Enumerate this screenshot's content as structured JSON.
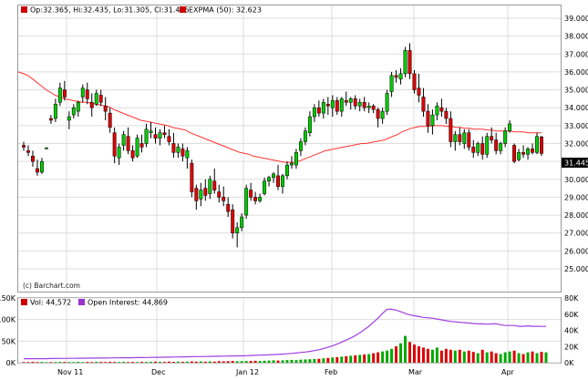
{
  "price_panel": {
    "legend": {
      "ohlc": "Op:32.365, Hi:32.435, Lo:31.305, Cl:31.445",
      "ema": "EXPMA (50): 32.623"
    },
    "watermark": "(c) Barchart.com",
    "last_price": "31.445",
    "colors": {
      "up": "#00cc00",
      "down": "#e00000",
      "ema": "#ff3333",
      "grid": "#dddddd",
      "legend_square": "#cc0000"
    }
  },
  "volume_panel": {
    "legend": {
      "volume": "Vol: 44,572",
      "open_interest": "Open Interest: 44,869"
    },
    "colors": {
      "volume_up": "#00aa00",
      "volume_down": "#dd0000",
      "open_interest": "#a040e0",
      "legend_square": "#cc0000",
      "oi_square": "#9933cc"
    }
  },
  "x_axis": {
    "labels": [
      "Nov 11",
      "Dec",
      "Jan 12",
      "Feb",
      "Mar",
      "Apr"
    ]
  },
  "chart_data": {
    "type": "candlestick",
    "price_axis": {
      "ticks": [
        "39.000",
        "38.000",
        "37.000",
        "36.000",
        "35.000",
        "34.000",
        "33.000",
        "32.000",
        "31.000",
        "30.000",
        "29.000",
        "28.000",
        "27.000",
        "26.000",
        "25.000"
      ],
      "range": [
        24.5,
        39.5
      ]
    },
    "volume_axis_left": {
      "ticks": [
        "0K",
        "50K",
        "100K",
        "150K"
      ],
      "range": [
        0,
        150000
      ]
    },
    "open_interest_axis_right": {
      "ticks": [
        "0K",
        "20K",
        "40K",
        "60K",
        "80K"
      ],
      "range": [
        0,
        80000
      ]
    },
    "candles": [
      [
        31.9,
        32.1,
        31.6,
        31.8
      ],
      [
        31.6,
        31.9,
        31.3,
        31.5
      ],
      [
        31.3,
        31.6,
        30.7,
        31.0
      ],
      [
        30.6,
        31.1,
        30.2,
        30.4
      ],
      [
        30.4,
        31.2,
        30.3,
        31.0
      ],
      [
        31.75,
        31.8,
        31.7,
        31.75
      ],
      [
        33.4,
        33.6,
        33.1,
        33.3
      ],
      [
        33.4,
        34.5,
        33.2,
        34.2
      ],
      [
        34.3,
        35.4,
        34.1,
        35.1
      ],
      [
        35.0,
        35.5,
        34.4,
        34.6
      ],
      [
        33.3,
        33.8,
        32.8,
        33.5
      ],
      [
        33.6,
        34.2,
        33.4,
        34.0
      ],
      [
        33.8,
        34.4,
        33.5,
        34.3
      ],
      [
        34.6,
        35.3,
        34.3,
        35.1
      ],
      [
        35.0,
        35.4,
        34.2,
        34.5
      ],
      [
        34.3,
        34.8,
        33.5,
        34.0
      ],
      [
        34.2,
        35.0,
        34.1,
        34.8
      ],
      [
        34.7,
        35.0,
        34.1,
        34.3
      ],
      [
        34.1,
        34.6,
        33.3,
        33.8
      ],
      [
        33.7,
        34.0,
        32.6,
        32.9
      ],
      [
        32.6,
        32.9,
        30.9,
        31.3
      ],
      [
        31.2,
        32.0,
        30.8,
        31.8
      ],
      [
        31.9,
        32.7,
        31.6,
        32.5
      ],
      [
        32.4,
        32.9,
        31.4,
        31.6
      ],
      [
        31.6,
        31.9,
        31.0,
        31.2
      ],
      [
        31.3,
        32.5,
        31.2,
        32.3
      ],
      [
        32.0,
        32.5,
        31.5,
        31.8
      ],
      [
        32.0,
        33.1,
        31.8,
        32.8
      ],
      [
        32.6,
        33.2,
        32.3,
        32.7
      ],
      [
        32.5,
        32.9,
        32.0,
        32.3
      ],
      [
        32.3,
        32.8,
        31.9,
        32.6
      ],
      [
        32.6,
        33.0,
        32.3,
        32.5
      ],
      [
        32.4,
        32.8,
        31.9,
        32.1
      ],
      [
        32.0,
        32.6,
        31.2,
        31.5
      ],
      [
        31.5,
        32.0,
        31.2,
        31.8
      ],
      [
        31.7,
        32.0,
        31.0,
        31.3
      ],
      [
        31.2,
        31.8,
        30.6,
        31.6
      ],
      [
        30.9,
        31.1,
        29.0,
        29.3
      ],
      [
        29.5,
        29.7,
        28.3,
        28.8
      ],
      [
        28.9,
        29.8,
        28.5,
        29.4
      ],
      [
        29.5,
        30.0,
        28.8,
        29.1
      ],
      [
        29.2,
        30.2,
        28.9,
        30.0
      ],
      [
        29.9,
        30.6,
        29.2,
        29.4
      ],
      [
        29.3,
        29.7,
        28.7,
        29.0
      ],
      [
        29.0,
        29.6,
        28.5,
        28.8
      ],
      [
        28.6,
        29.0,
        27.9,
        28.2
      ],
      [
        28.3,
        28.6,
        26.7,
        27.0
      ],
      [
        27.0,
        27.6,
        26.2,
        27.3
      ],
      [
        27.3,
        28.1,
        27.1,
        27.9
      ],
      [
        28.0,
        29.7,
        27.8,
        29.5
      ],
      [
        29.4,
        29.8,
        28.8,
        29.0
      ],
      [
        29.0,
        29.3,
        28.6,
        28.8
      ],
      [
        28.8,
        29.2,
        28.7,
        29.0
      ],
      [
        29.2,
        30.1,
        29.1,
        29.9
      ],
      [
        29.9,
        30.2,
        29.6,
        30.1
      ],
      [
        30.1,
        30.4,
        29.8,
        30.3
      ],
      [
        30.2,
        30.8,
        29.4,
        29.6
      ],
      [
        29.6,
        30.3,
        29.2,
        30.2
      ],
      [
        30.2,
        31.0,
        30.0,
        30.8
      ],
      [
        30.8,
        31.3,
        30.6,
        30.9
      ],
      [
        30.8,
        31.7,
        30.6,
        31.5
      ],
      [
        31.6,
        32.3,
        31.3,
        32.1
      ],
      [
        32.1,
        32.9,
        31.9,
        32.7
      ],
      [
        32.6,
        33.8,
        32.4,
        33.5
      ],
      [
        33.5,
        34.2,
        33.2,
        34.0
      ],
      [
        34.0,
        34.4,
        33.5,
        33.7
      ],
      [
        33.7,
        34.5,
        33.4,
        34.3
      ],
      [
        34.2,
        34.6,
        33.6,
        34.1
      ],
      [
        34.0,
        34.7,
        33.5,
        34.4
      ],
      [
        34.4,
        34.6,
        33.6,
        33.8
      ],
      [
        33.8,
        34.6,
        33.5,
        34.5
      ],
      [
        34.4,
        34.9,
        34.1,
        34.3
      ],
      [
        34.3,
        34.6,
        33.9,
        34.5
      ],
      [
        34.5,
        34.7,
        33.9,
        34.1
      ],
      [
        34.1,
        34.5,
        33.8,
        34.3
      ],
      [
        34.3,
        34.6,
        33.8,
        34.0
      ],
      [
        34.0,
        34.3,
        33.7,
        34.1
      ],
      [
        34.1,
        34.2,
        33.7,
        33.9
      ],
      [
        33.9,
        34.0,
        32.9,
        33.4
      ],
      [
        33.4,
        34.0,
        33.1,
        33.8
      ],
      [
        33.8,
        35.0,
        33.6,
        34.8
      ],
      [
        34.9,
        36.0,
        34.6,
        35.8
      ],
      [
        35.8,
        36.1,
        35.4,
        35.7
      ],
      [
        35.6,
        36.2,
        35.3,
        35.9
      ],
      [
        35.9,
        37.4,
        35.7,
        37.2
      ],
      [
        37.2,
        37.6,
        35.6,
        35.9
      ],
      [
        35.9,
        36.1,
        34.8,
        35.0
      ],
      [
        35.1,
        35.9,
        34.3,
        34.7
      ],
      [
        34.6,
        35.1,
        33.5,
        33.8
      ],
      [
        33.8,
        34.2,
        32.6,
        33.0
      ],
      [
        33.0,
        33.9,
        32.5,
        33.6
      ],
      [
        33.6,
        34.3,
        33.3,
        34.1
      ],
      [
        34.0,
        34.5,
        33.5,
        33.8
      ],
      [
        33.8,
        34.0,
        33.1,
        33.4
      ],
      [
        33.4,
        33.8,
        31.8,
        32.1
      ],
      [
        32.1,
        32.7,
        31.6,
        32.5
      ],
      [
        32.5,
        32.9,
        31.9,
        32.1
      ],
      [
        32.0,
        32.8,
        31.7,
        32.6
      ],
      [
        32.6,
        32.8,
        31.6,
        31.8
      ],
      [
        31.8,
        32.2,
        31.2,
        31.5
      ],
      [
        31.5,
        32.1,
        31.3,
        32.0
      ],
      [
        32.0,
        32.4,
        31.1,
        31.4
      ],
      [
        31.4,
        32.6,
        31.2,
        32.4
      ],
      [
        32.4,
        32.9,
        32.0,
        32.2
      ],
      [
        32.2,
        32.6,
        31.4,
        31.6
      ],
      [
        31.6,
        32.1,
        31.4,
        32.0
      ],
      [
        32.0,
        32.9,
        31.8,
        32.7
      ],
      [
        32.7,
        33.3,
        32.6,
        33.1
      ],
      [
        31.9,
        32.0,
        30.9,
        31.0
      ],
      [
        31.1,
        31.7,
        31.0,
        31.5
      ],
      [
        31.5,
        31.9,
        31.2,
        31.4
      ],
      [
        31.4,
        31.8,
        31.1,
        31.7
      ],
      [
        31.7,
        32.0,
        31.4,
        31.5
      ],
      [
        31.5,
        32.6,
        31.4,
        32.4
      ],
      [
        32.365,
        32.435,
        31.305,
        31.445
      ]
    ],
    "ema50": [
      35.9,
      35.8,
      35.6,
      35.4,
      35.2,
      35.0,
      34.85,
      34.7,
      34.6,
      34.5,
      34.45,
      34.4,
      34.35,
      34.3,
      34.3,
      34.25,
      34.2,
      34.15,
      34.1,
      34.05,
      33.9,
      33.8,
      33.7,
      33.6,
      33.5,
      33.4,
      33.3,
      33.25,
      33.2,
      33.15,
      33.1,
      33.05,
      33.0,
      32.9,
      32.85,
      32.8,
      32.75,
      32.6,
      32.5,
      32.4,
      32.3,
      32.2,
      32.1,
      32.0,
      31.9,
      31.8,
      31.7,
      31.6,
      31.5,
      31.45,
      31.4,
      31.3,
      31.25,
      31.2,
      31.15,
      31.1,
      31.05,
      31.0,
      30.95,
      30.95,
      30.95,
      31.0,
      31.1,
      31.2,
      31.3,
      31.4,
      31.5,
      31.6,
      31.65,
      31.7,
      31.75,
      31.8,
      31.85,
      31.9,
      31.95,
      32.0,
      32.0,
      32.05,
      32.1,
      32.15,
      32.2,
      32.3,
      32.4,
      32.5,
      32.65,
      32.75,
      32.85,
      32.9,
      32.95,
      32.95,
      32.95,
      33.0,
      33.0,
      33.0,
      32.95,
      32.95,
      32.9,
      32.9,
      32.85,
      32.85,
      32.8,
      32.8,
      32.8,
      32.75,
      32.75,
      32.7,
      32.7,
      32.7,
      32.7,
      32.65,
      32.65,
      32.65,
      32.6,
      32.6,
      32.6,
      32.6
    ],
    "volume": [
      1500,
      1500,
      2000,
      1500,
      1800,
      1200,
      1500,
      1500,
      2000,
      1800,
      1500,
      1500,
      2000,
      1500,
      1800,
      1500,
      2000,
      1800,
      1500,
      2000,
      1800,
      1500,
      2000,
      1500,
      1800,
      1500,
      2000,
      1800,
      2000,
      2500,
      2000,
      1800,
      2500,
      2000,
      2500,
      2000,
      2500,
      3000,
      2500,
      3000,
      2500,
      3000,
      2500,
      3500,
      3000,
      3500,
      4000,
      3500,
      3500,
      4000,
      4000,
      4500,
      4000,
      4500,
      5000,
      5500,
      5000,
      5500,
      6000,
      6500,
      6000,
      7000,
      7500,
      8000,
      8500,
      9000,
      10000,
      11000,
      12000,
      13000,
      14000,
      15000,
      16000,
      17000,
      18000,
      19000,
      20000,
      22000,
      24000,
      26000,
      28000,
      32000,
      38000,
      45000,
      62000,
      48000,
      42000,
      38000,
      35000,
      32000,
      30000,
      35000,
      28000,
      32000,
      30000,
      28000,
      30000,
      26000,
      28000,
      25000,
      22000,
      30000,
      24000,
      26000,
      22000,
      20000,
      24000,
      26000,
      28000,
      22000,
      20000,
      24000,
      26000,
      22000,
      25000,
      24000
    ],
    "open_interest": [
      5000,
      5000,
      5000,
      5000,
      5000,
      5000,
      5200,
      5200,
      5300,
      5300,
      5400,
      5400,
      5500,
      5500,
      5600,
      5600,
      5700,
      5800,
      5800,
      5900,
      6000,
      6000,
      6100,
      6100,
      6200,
      6300,
      6300,
      6400,
      6500,
      6600,
      6700,
      6800,
      6900,
      7000,
      7100,
      7200,
      7300,
      7400,
      7500,
      7600,
      7700,
      7800,
      7900,
      8000,
      8100,
      8200,
      8300,
      8400,
      8500,
      8700,
      8900,
      9100,
      9300,
      9500,
      9700,
      10000,
      10300,
      10600,
      11000,
      11500,
      12000,
      12600,
      13200,
      14000,
      15000,
      16000,
      17500,
      19000,
      21000,
      23000,
      25500,
      28000,
      30500,
      33500,
      37000,
      41000,
      45000,
      50000,
      55000,
      61000,
      66000,
      66000,
      65000,
      63000,
      61000,
      59000,
      58000,
      57000,
      56000,
      55500,
      55000,
      54000,
      53000,
      52000,
      51000,
      50500,
      50000,
      49500,
      49000,
      48500,
      48000,
      48000,
      47500,
      48000,
      48000,
      47000,
      46000,
      46000,
      46000,
      45000,
      45000,
      45500,
      45000,
      45000,
      44869,
      44869
    ]
  }
}
